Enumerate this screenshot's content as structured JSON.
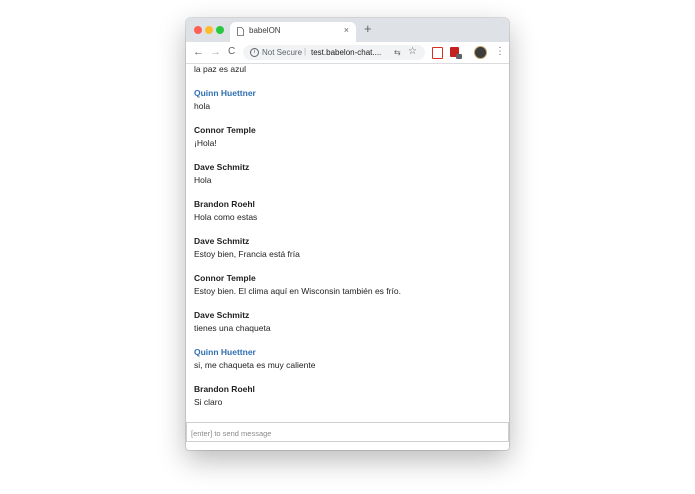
{
  "browser": {
    "tab_title": "babelON",
    "tab_close": "×",
    "new_tab": "+",
    "security_label": "Not Secure",
    "url_separator": "|",
    "url": "test.babelon-chat....",
    "nav": {
      "back": "←",
      "forward": "→",
      "reload": "C"
    },
    "menu": "⋮",
    "icons": [
      "page-icon",
      "info-icon",
      "translate-icon",
      "star-icon",
      "pdf-extension-icon",
      "extension-icon",
      "profile-avatar",
      "menu-icon"
    ],
    "colors": {
      "close": "#ff5f57",
      "minimize": "#febc2e",
      "maximize": "#28c840"
    }
  },
  "chat": {
    "partial_message": "la paz es azul",
    "messages": [
      {
        "author": "Quinn Huettner",
        "text": "hola",
        "self": true
      },
      {
        "author": "Connor Temple",
        "text": "¡Hola!",
        "self": false
      },
      {
        "author": "Dave Schmitz",
        "text": "Hola",
        "self": false
      },
      {
        "author": "Brandon Roehl",
        "text": "Hola como estas",
        "self": false
      },
      {
        "author": "Dave Schmitz",
        "text": "Estoy bien, Francia está fría",
        "self": false
      },
      {
        "author": "Connor Temple",
        "text": "Estoy bien. El clima aquí en Wisconsin también es frío.",
        "self": false
      },
      {
        "author": "Dave Schmitz",
        "text": "tienes una chaqueta",
        "self": false
      },
      {
        "author": "Quinn Huettner",
        "text": "si, me chaqueta es muy caliente",
        "self": true
      },
      {
        "author": "Brandon Roehl",
        "text": "Si claro",
        "self": false
      }
    ],
    "self_author_color": "#2f6fb1",
    "input_placeholder": "[enter] to send message"
  }
}
